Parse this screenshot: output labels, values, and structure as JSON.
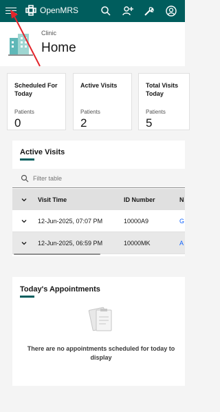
{
  "topbar": {
    "brand": "OpenMRS",
    "background": "#005d5d",
    "icons": [
      "menu-icon",
      "search-icon",
      "add-patient-icon",
      "tools-icon",
      "user-icon"
    ]
  },
  "header": {
    "location": "Clinic",
    "title": "Home"
  },
  "metrics": [
    {
      "title": "Scheduled For Today",
      "sub": "Patients",
      "value": "0"
    },
    {
      "title": "Active Visits",
      "sub": "Patients",
      "value": "2"
    },
    {
      "title": "Total Visits Today",
      "sub": "Patients",
      "value": "5"
    }
  ],
  "active_visits": {
    "title": "Active Visits",
    "filter_placeholder": "Filter table",
    "columns": [
      "Visit Time",
      "ID Number",
      "N"
    ],
    "rows": [
      {
        "visit_time": "12-Jun-2025, 07:07 PM",
        "id": "10000A9",
        "name": "G"
      },
      {
        "visit_time": "12-Jun-2025, 06:59 PM",
        "id": "10000MK",
        "name": "A"
      }
    ]
  },
  "appointments": {
    "title": "Today's Appointments",
    "empty_message": "There are no appointments scheduled for today to display"
  }
}
